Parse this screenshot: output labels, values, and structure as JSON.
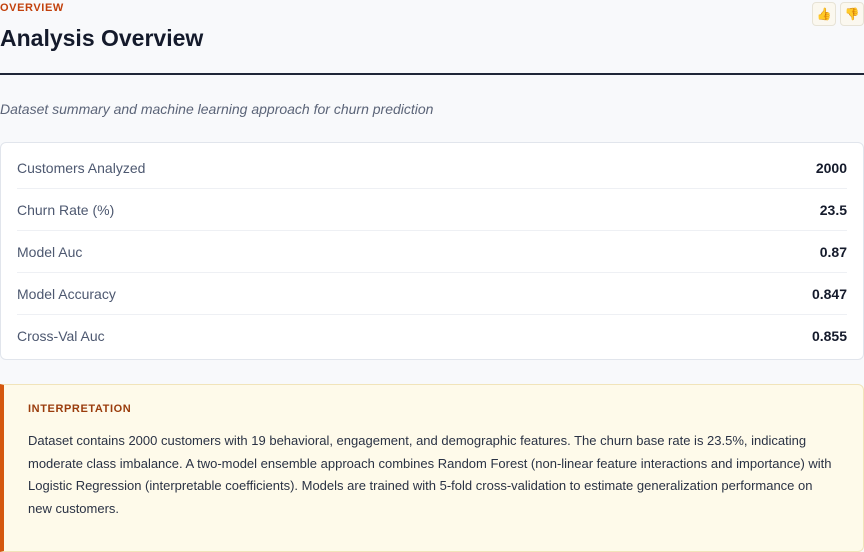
{
  "header": {
    "eyebrow": "OVERVIEW",
    "title": "Analysis Overview",
    "subtitle": "Dataset summary and machine learning approach for churn prediction"
  },
  "feedback": {
    "thumbs_up_icon": "thumbs-up-icon",
    "thumbs_down_icon": "thumbs-down-icon"
  },
  "metrics": [
    {
      "label": "Customers Analyzed",
      "value": "2000"
    },
    {
      "label": "Churn Rate (%)",
      "value": "23.5"
    },
    {
      "label": "Model Auc",
      "value": "0.87"
    },
    {
      "label": "Model Accuracy",
      "value": "0.847"
    },
    {
      "label": "Cross-Val Auc",
      "value": "0.855"
    }
  ],
  "interpretation": {
    "heading": "INTERPRETATION",
    "body": "Dataset contains 2000 customers with 19 behavioral, engagement, and demographic features. The churn base rate is 23.5%, indicating moderate class imbalance. A two-model ensemble approach combines Random Forest (non-linear feature interactions and importance) with Logistic Regression (interpretable coefficients). Models are trained with 5-fold cross-validation to estimate generalization performance on new customers."
  },
  "colors": {
    "accent": "#c2410c",
    "callout_border": "#d4570f",
    "callout_bg": "#fefaea"
  }
}
